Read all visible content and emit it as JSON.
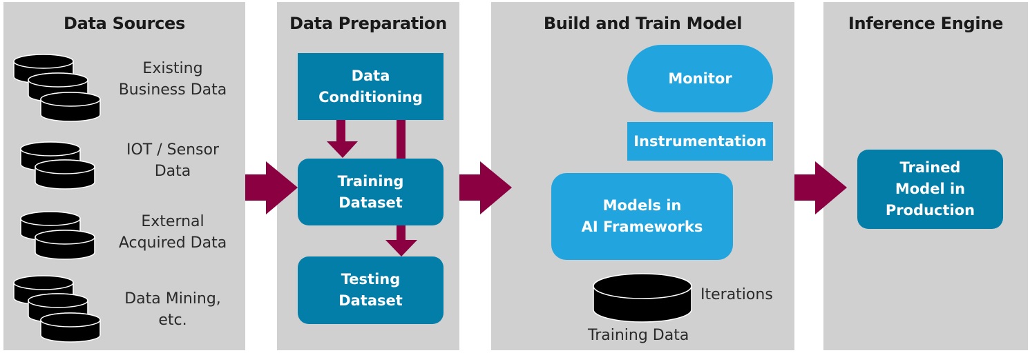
{
  "colors": {
    "panel_bg": "#d0d0d0",
    "dark_box": "#037ea8",
    "light_box": "#22a5de",
    "arrow": "#8b0040",
    "disk": "#000000"
  },
  "panels": [
    {
      "title": "Data Sources",
      "sources": [
        {
          "label_line1": "Existing",
          "label_line2": "Business Data",
          "disk_count": 3,
          "icon": "database-stack-icon"
        },
        {
          "label_line1": "IOT / Sensor",
          "label_line2": "Data",
          "disk_count": 2,
          "icon": "database-stack-icon"
        },
        {
          "label_line1": "External",
          "label_line2": "Acquired Data",
          "disk_count": 2,
          "icon": "database-stack-icon"
        },
        {
          "label_line1": "Data Mining,",
          "label_line2": "etc.",
          "disk_count": 3,
          "icon": "database-stack-icon"
        }
      ]
    },
    {
      "title": "Data Preparation",
      "boxes": {
        "conditioning": {
          "line1": "Data",
          "line2": "Conditioning"
        },
        "training": {
          "line1": "Training",
          "line2": "Dataset"
        },
        "testing": {
          "line1": "Testing",
          "line2": "Dataset"
        }
      }
    },
    {
      "title": "Build and Train Model",
      "boxes": {
        "monitor": "Monitor",
        "instrumentation": "Instrumentation",
        "models": {
          "line1": "Models in",
          "line2": "AI Frameworks"
        }
      },
      "training_data_label": "Training Data",
      "iterations_label": "Iterations"
    },
    {
      "title": "Inference Engine",
      "boxes": {
        "trained": {
          "line1": "Trained",
          "line2": "Model in",
          "line3": "Production"
        }
      }
    }
  ]
}
